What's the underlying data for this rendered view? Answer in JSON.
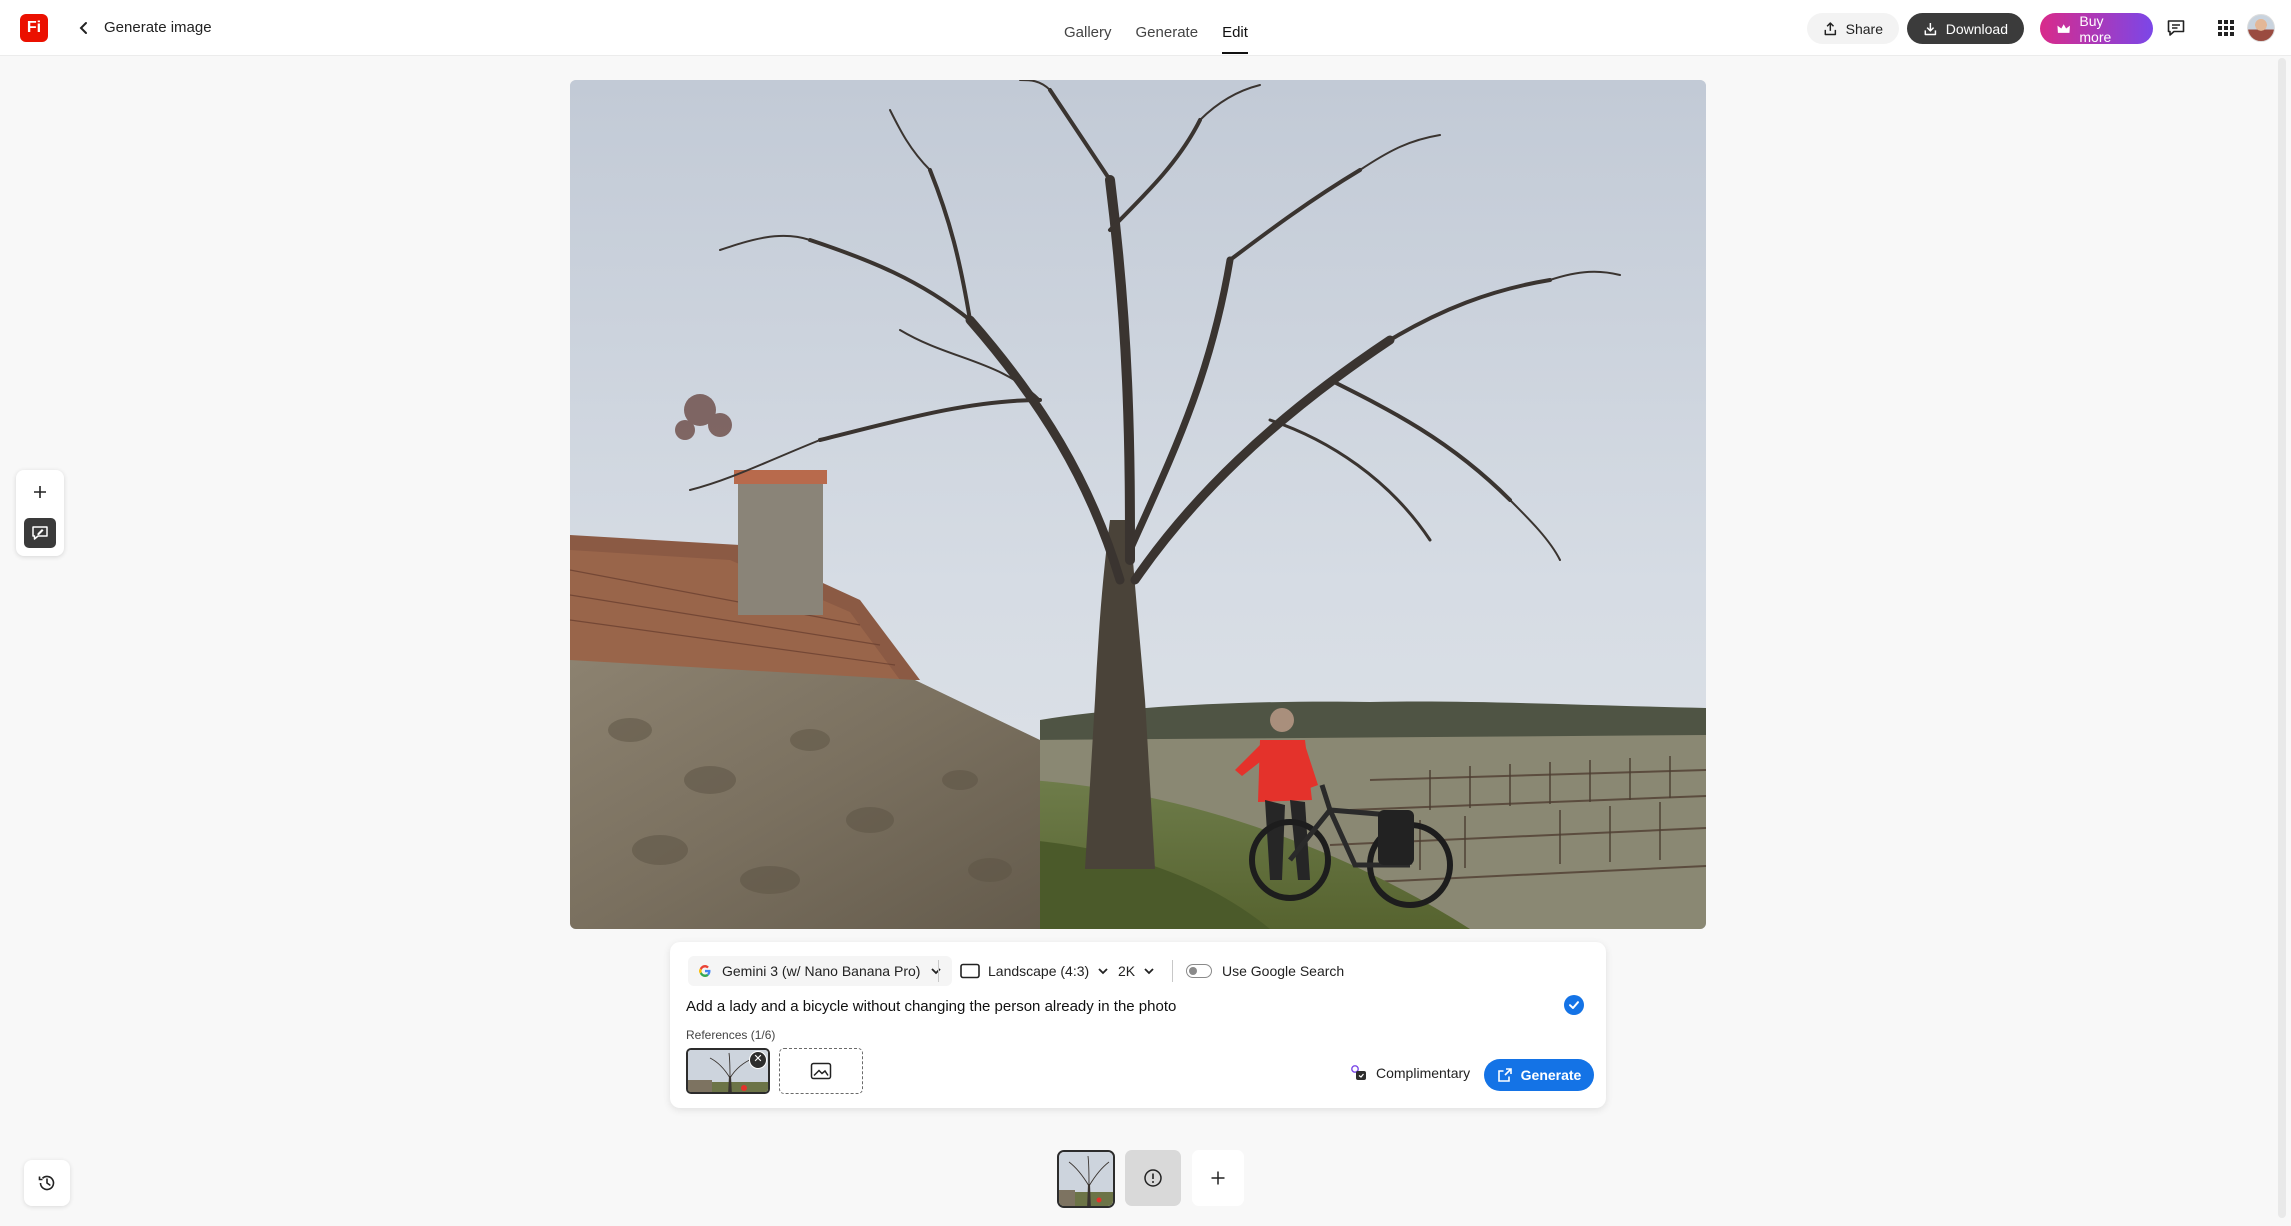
{
  "header": {
    "logo_text": "Fi",
    "title": "Generate image",
    "nav": [
      {
        "label": "Gallery"
      },
      {
        "label": "Generate"
      },
      {
        "label": "Edit",
        "active": true
      }
    ],
    "share_label": "Share",
    "download_label": "Download",
    "buy_more_label": "Buy more"
  },
  "prompt_panel": {
    "model_label": "Gemini 3 (w/ Nano Banana Pro)",
    "aspect_label": "Landscape (4:3)",
    "resolution_label": "2K",
    "google_search_label": "Use Google Search",
    "google_search_enabled": false,
    "prompt_text": "Add a lady and a bicycle without changing the person already in the photo",
    "references_label": "References (1/6)",
    "complimentary_label": "Complimentary",
    "generate_label": "Generate"
  },
  "colors": {
    "accent": "#1473e6",
    "brand": "#eb1000",
    "buy_gradient_start": "#d92a8a",
    "buy_gradient_end": "#7b47e8"
  },
  "icons": {
    "back": "chevron-left-icon",
    "share": "share-icon",
    "download": "download-icon",
    "buy": "crown-icon",
    "feedback": "chat-icon",
    "apps": "grid-icon",
    "history": "history-icon",
    "add": "plus-icon"
  }
}
